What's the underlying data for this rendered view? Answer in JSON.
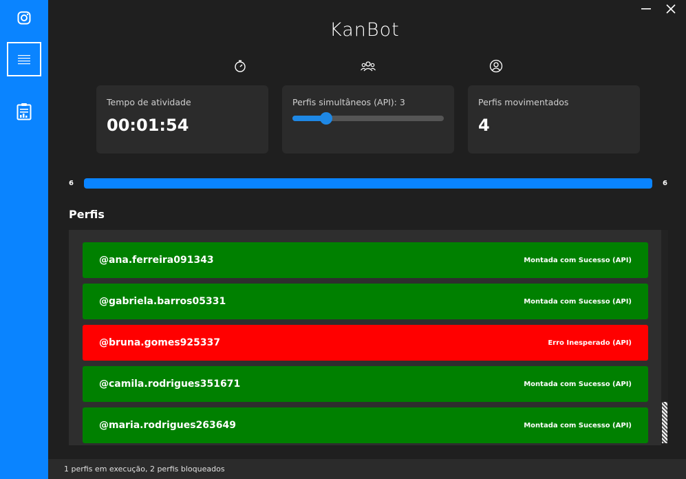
{
  "app": {
    "logo": "KanBot"
  },
  "sidebar": {
    "items": [
      {
        "icon": "instagram-icon"
      },
      {
        "icon": "menu-icon",
        "active": true
      },
      {
        "icon": "report-icon"
      }
    ]
  },
  "window": {
    "minimize_icon": "minimize-icon",
    "close_icon": "close-icon"
  },
  "stats": {
    "uptime": {
      "icon": "stopwatch-icon",
      "label": "Tempo de atividade",
      "value": "00:01:54"
    },
    "simultaneous": {
      "icon": "users-icon",
      "label": "Perfis simultâneos (API): 3",
      "value": 3,
      "min": 1,
      "max": 10
    },
    "moved": {
      "icon": "user-circle-icon",
      "label": "Perfis movimentados",
      "value": "4"
    }
  },
  "progress": {
    "left_label": "6",
    "right_label": "6",
    "fraction": 1.0,
    "color": "#0a84ff"
  },
  "profiles": {
    "title": "Perfis",
    "items": [
      {
        "name": "@ana.ferreira091343",
        "status": "Montada com Sucesso (API)",
        "color": "#008000"
      },
      {
        "name": "@gabriela.barros05331",
        "status": "Montada com Sucesso (API)",
        "color": "#008000"
      },
      {
        "name": "@bruna.gomes925337",
        "status": "Erro Inesperado (API)",
        "color": "#ff0000"
      },
      {
        "name": "@camila.rodrigues351671",
        "status": "Montada com Sucesso (API)",
        "color": "#008000"
      },
      {
        "name": "@maria.rodrigues263649",
        "status": "Montada com Sucesso (API)",
        "color": "#008000"
      }
    ]
  },
  "statusbar": {
    "text": "1 perfis em execução, 2 perfis bloqueados"
  }
}
